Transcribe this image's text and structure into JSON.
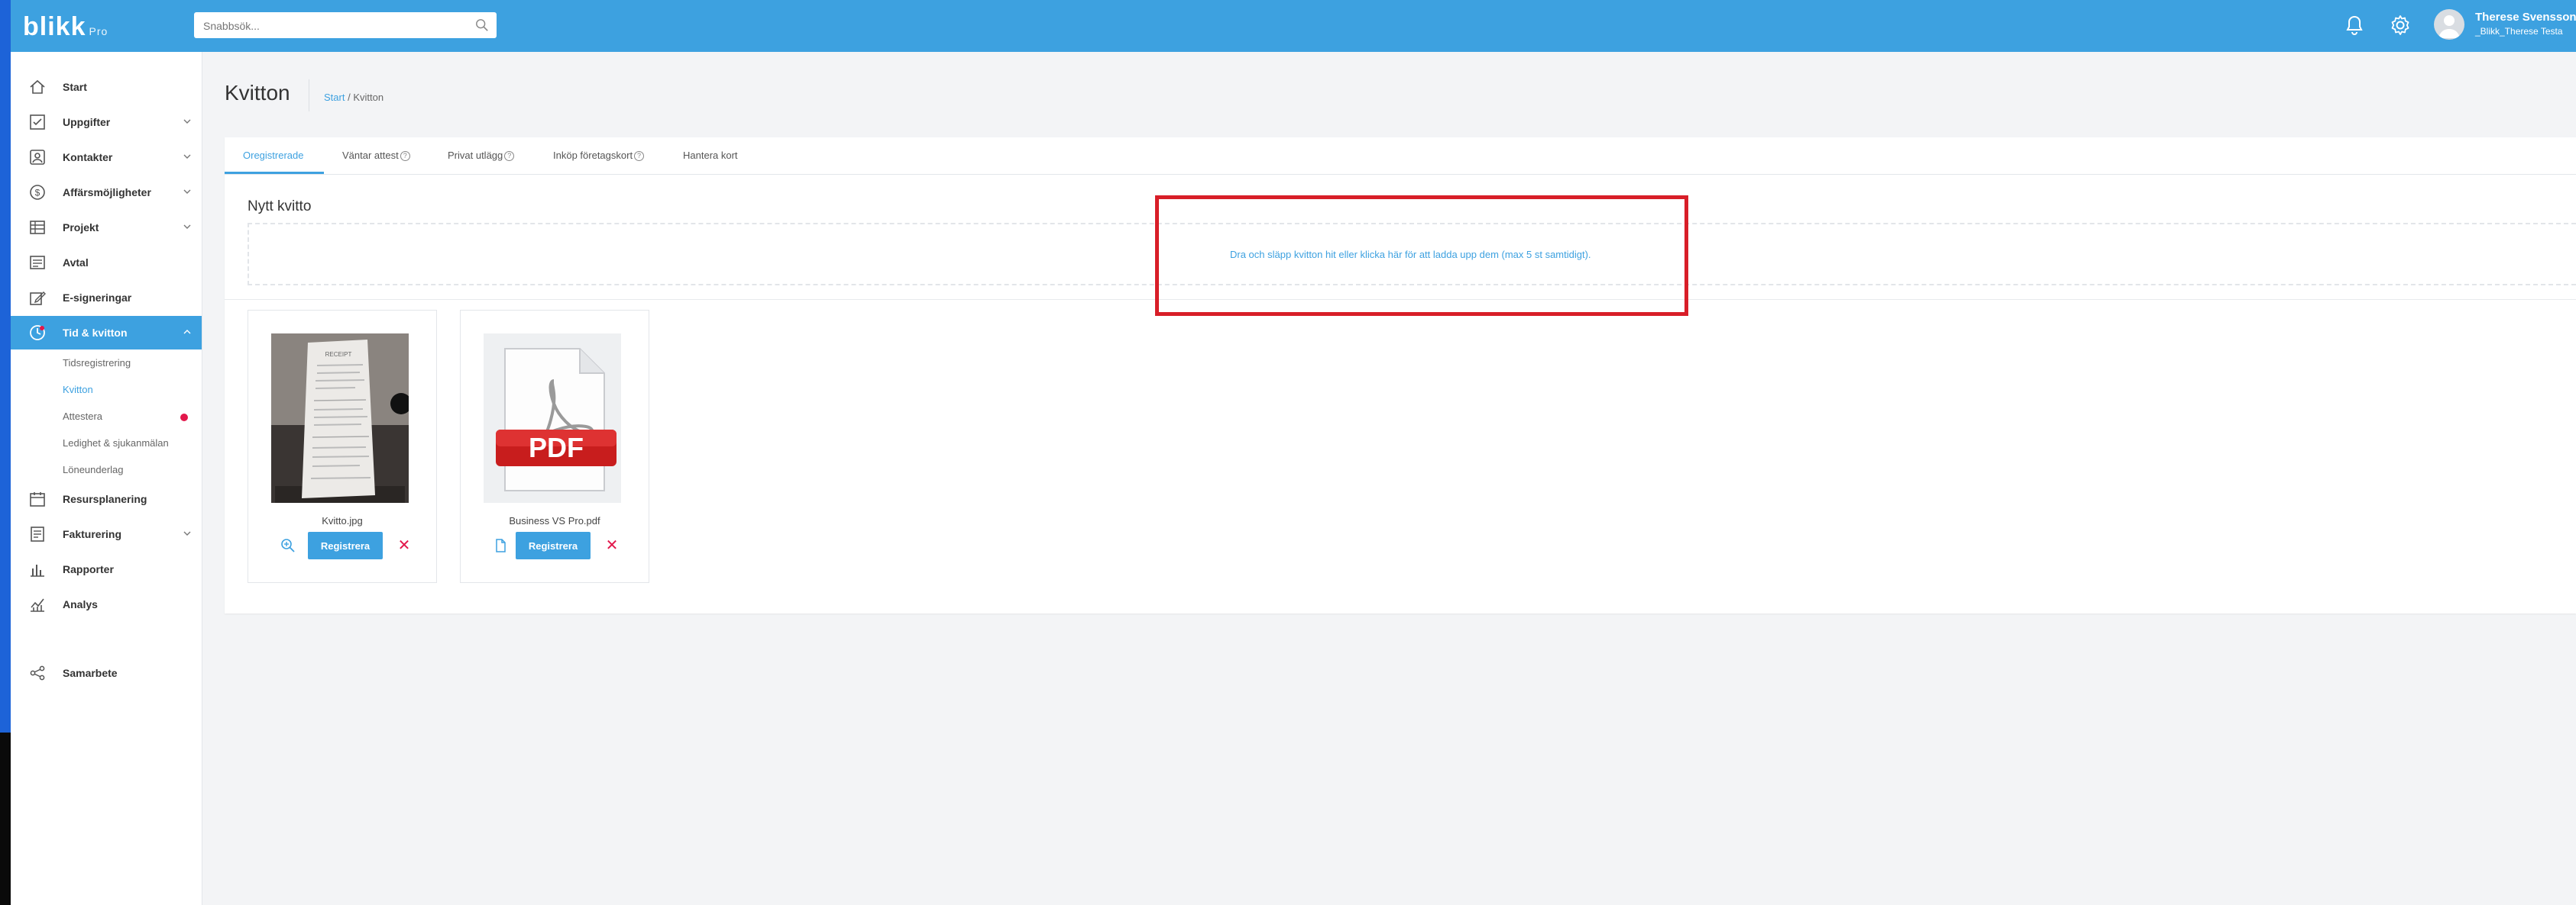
{
  "app": {
    "logo_text": "blikk",
    "logo_suffix": "Pro"
  },
  "header": {
    "search_placeholder": "Snabbsök...",
    "user_name": "Therese Svensson",
    "user_company": "_Blikk_Therese Testa"
  },
  "sidebar": {
    "items": [
      {
        "label": "Start",
        "icon": "home-icon"
      },
      {
        "label": "Uppgifter",
        "icon": "checkbox-icon"
      },
      {
        "label": "Kontakter",
        "icon": "contact-card-icon"
      },
      {
        "label": "Affärsmöjligheter",
        "icon": "dollar-icon"
      },
      {
        "label": "Projekt",
        "icon": "table-icon"
      },
      {
        "label": "Avtal",
        "icon": "contract-icon"
      },
      {
        "label": "E-signeringar",
        "icon": "signature-icon"
      },
      {
        "label": "Tid & kvitton",
        "icon": "clock-icon"
      },
      {
        "label": "Resursplanering",
        "icon": "calendar-icon"
      },
      {
        "label": "Fakturering",
        "icon": "invoice-icon"
      },
      {
        "label": "Rapporter",
        "icon": "bar-chart-icon"
      },
      {
        "label": "Analys",
        "icon": "analytics-icon"
      },
      {
        "label": "Samarbete",
        "icon": "share-icon"
      }
    ],
    "subitems": [
      "Tidsregistrering",
      "Kvitton",
      "Attestera",
      "Ledighet & sjukanmälan",
      "Löneunderlag"
    ]
  },
  "page": {
    "title": "Kvitton",
    "breadcrumb_start": "Start",
    "breadcrumb_sep": " / ",
    "breadcrumb_current": "Kvitton"
  },
  "tabs": [
    "Oregistrerade",
    "Väntar attest",
    "Privat utlägg",
    "Inköp företagskort",
    "Hantera kort"
  ],
  "upload": {
    "section_title": "Nytt kvitto",
    "dropzone_text": "Dra och släpp kvitton hit eller klicka här för att ladda upp dem (max 5 st samtidigt)."
  },
  "files": [
    {
      "name": "Kvitto.jpg",
      "button": "Registrera",
      "thumb_label": "RECEIPT"
    },
    {
      "name": "Business VS Pro.pdf",
      "button": "Registrera",
      "thumb_label": "PDF"
    }
  ],
  "colors": {
    "accent": "#3da1e0",
    "highlight": "#d81e28",
    "badge": "#e2174b"
  }
}
